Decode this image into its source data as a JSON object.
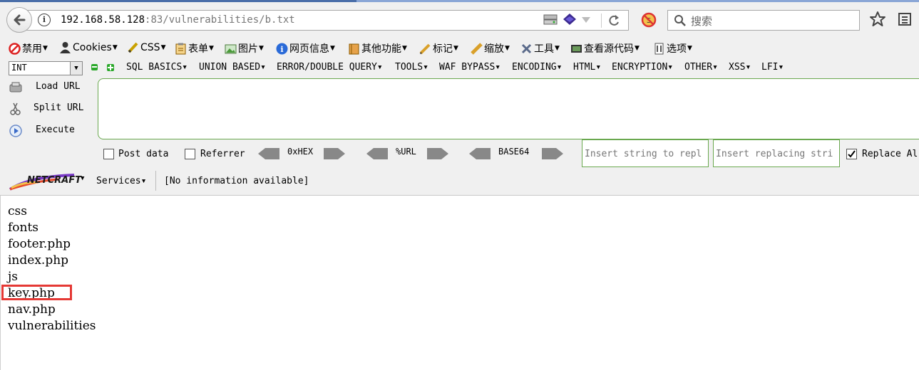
{
  "browser": {
    "url_host": "192.168.58.128",
    "url_rest": ":83/vulnerabilities/b.txt",
    "search_placeholder": "搜索"
  },
  "web_developer_toolbar": {
    "items": [
      "禁用",
      "Cookies",
      "CSS",
      "表单",
      "图片",
      "网页信息",
      "其他功能",
      "标记",
      "缩放",
      "工具",
      "查看源代码",
      "选项"
    ]
  },
  "hackbar": {
    "type_select": "INT",
    "menus": [
      "SQL BASICS",
      "UNION BASED",
      "ERROR/DOUBLE QUERY",
      "TOOLS",
      "WAF BYPASS",
      "ENCODING",
      "HTML",
      "ENCRYPTION",
      "OTHER",
      "XSS",
      "LFI"
    ],
    "load_url": "Load URL",
    "split_url": "Split URL",
    "execute": "Execute",
    "post_data": "Post data",
    "referrer": "Referrer",
    "hex": "0xHEX",
    "url_enc": "%URL",
    "base64": "BASE64",
    "insert_string_placeholder": "Insert string to repl",
    "insert_replacing_placeholder": "Insert replacing stri",
    "replace_all": "Replace Al",
    "replace_all_checked": true
  },
  "netcraft": {
    "logo": "NETCRAFT",
    "services": "Services",
    "info": "[No information available]"
  },
  "page_content": {
    "files": [
      "css",
      "fonts",
      "footer.php",
      "index.php",
      "js",
      "key.php",
      "nav.php",
      "vulnerabilities"
    ],
    "highlight_color": "#e53935"
  }
}
